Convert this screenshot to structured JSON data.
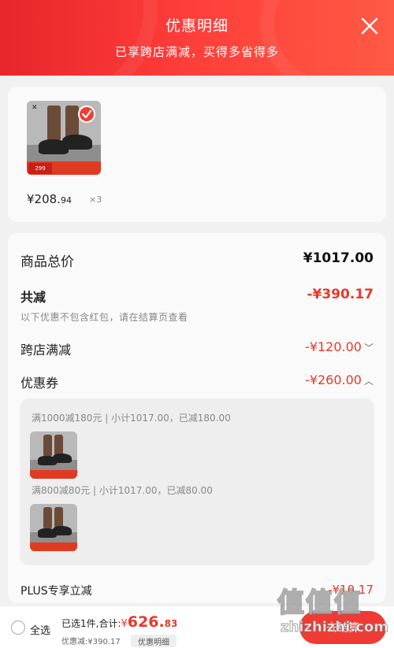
{
  "header": {
    "title": "优惠明细",
    "subtitle": "已享跨店满减，买得多省得多"
  },
  "product": {
    "price_int": "¥208.",
    "price_dec": "94",
    "quantity": "×3",
    "thumb_tag_price": "299"
  },
  "summary": {
    "total_label": "商品总价",
    "total_value": "¥1017.00",
    "discount_label": "共减",
    "discount_value": "-¥390.17",
    "note": "以下优惠不包含红包，请在结算页查看",
    "cross_store_label": "跨店满减",
    "cross_store_value": "-¥120.00",
    "coupon_label": "优惠券",
    "coupon_value": "-¥260.00",
    "coupons": [
      {
        "text": "满1000减180元 | 小计1017.00，已减180.00"
      },
      {
        "text": "满800减80元 | 小计1017.00，已减80.00"
      }
    ],
    "plus_label": "PLUS专享立减",
    "plus_value": "-¥10.17"
  },
  "bottom_bar": {
    "select_all": "全选",
    "selected_prefix": "已选1件,合计:",
    "total_currency": "¥",
    "total_int": "626.",
    "total_dec": "83",
    "discount_line": "优惠减:¥390.17",
    "detail_button": "优惠明细",
    "settle_button": "去结算"
  },
  "watermark": {
    "glyphs": "值值值",
    "url": "zhizhizhi.com"
  },
  "colors": {
    "accent": "#ef3b33",
    "price_red": "#e8392a"
  },
  "icons": {
    "close": "close-icon",
    "check": "check-icon",
    "chevron_down": "chevron-down-icon",
    "chevron_up": "chevron-up-icon"
  }
}
